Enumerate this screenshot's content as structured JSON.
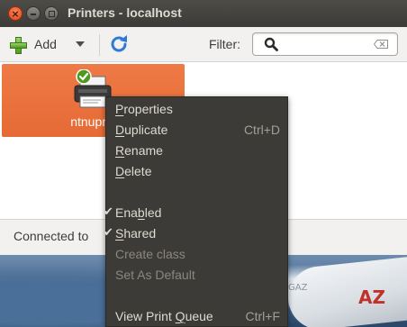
{
  "window": {
    "title": "Printers - localhost"
  },
  "toolbar": {
    "add_label": "Add",
    "filter_label": "Filter:",
    "filter_value": ""
  },
  "printers": [
    {
      "name": "ntnuprin",
      "status": "default"
    }
  ],
  "statusbar": {
    "text": "Connected to"
  },
  "context_menu": {
    "items": [
      {
        "label": "Properties",
        "mnemonic": "P",
        "accelerator": "",
        "enabled": true,
        "checked": false
      },
      {
        "label": "Duplicate",
        "mnemonic": "D",
        "accelerator": "Ctrl+D",
        "enabled": true,
        "checked": false
      },
      {
        "label": "Rename",
        "mnemonic": "R",
        "accelerator": "",
        "enabled": true,
        "checked": false
      },
      {
        "label": "Delete",
        "mnemonic": "D",
        "accelerator": "",
        "enabled": true,
        "checked": false
      },
      {
        "label": "Enabled",
        "mnemonic": "b",
        "accelerator": "",
        "enabled": true,
        "checked": true
      },
      {
        "label": "Shared",
        "mnemonic": "S",
        "accelerator": "",
        "enabled": true,
        "checked": true
      },
      {
        "label": "Create class",
        "mnemonic": "",
        "accelerator": "",
        "enabled": false,
        "checked": false
      },
      {
        "label": "Set As Default",
        "mnemonic": "",
        "accelerator": "",
        "enabled": false,
        "checked": false
      },
      {
        "label": "View Print Queue",
        "mnemonic": "Q",
        "accelerator": "Ctrl+F",
        "enabled": true,
        "checked": false
      }
    ]
  },
  "desktop": {
    "registration": "AZ",
    "tail_text": "GAZ"
  },
  "colors": {
    "titlebar": "#3c3b37",
    "selected_printer": "#e56a36",
    "menu_bg": "#3c3b37",
    "menu_text": "#dfdbd2"
  }
}
